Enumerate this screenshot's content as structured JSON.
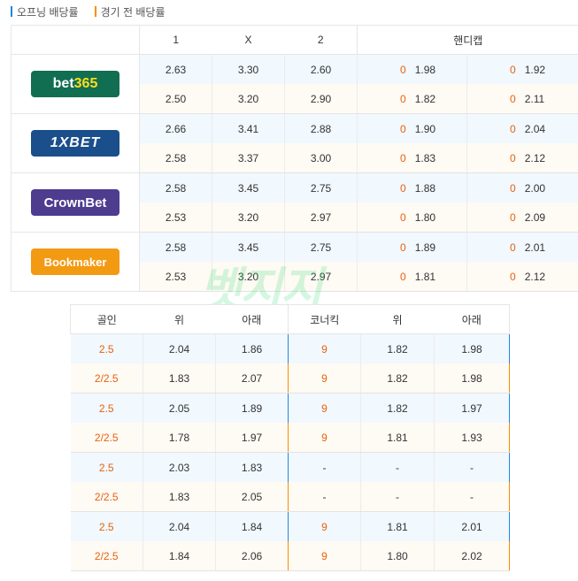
{
  "legend": {
    "opening": "오프닝 배당률",
    "pre_match": "경기 전 배당률"
  },
  "top_headers": {
    "one": "1",
    "x": "X",
    "two": "2",
    "handicap": "핸디캡"
  },
  "bookmakers": [
    {
      "name_a": "bet",
      "name_b": "365",
      "open": [
        "2.63",
        "3.30",
        "2.60",
        "0",
        "1.98",
        "0",
        "1.92"
      ],
      "close": [
        "2.50",
        "3.20",
        "2.90",
        "0",
        "1.82",
        "0",
        "2.11"
      ]
    },
    {
      "name": "1XBET",
      "open": [
        "2.66",
        "3.41",
        "2.88",
        "0",
        "1.90",
        "0",
        "2.04"
      ],
      "close": [
        "2.58",
        "3.37",
        "3.00",
        "0",
        "1.83",
        "0",
        "2.12"
      ]
    },
    {
      "name": "CrownBet",
      "open": [
        "2.58",
        "3.45",
        "2.75",
        "0",
        "1.88",
        "0",
        "2.00"
      ],
      "close": [
        "2.53",
        "3.20",
        "2.97",
        "0",
        "1.80",
        "0",
        "2.09"
      ]
    },
    {
      "name": "Bookmaker",
      "open": [
        "2.58",
        "3.45",
        "2.75",
        "0",
        "1.89",
        "0",
        "2.01"
      ],
      "close": [
        "2.53",
        "3.20",
        "2.97",
        "0",
        "1.81",
        "0",
        "2.12"
      ]
    }
  ],
  "bottom_headers": {
    "goal": "골인",
    "over": "위",
    "under": "아래",
    "corner": "코너킥",
    "over2": "위",
    "under2": "아래"
  },
  "bottom_rows": [
    [
      "2.5",
      "2.04",
      "1.86",
      "9",
      "1.82",
      "1.98"
    ],
    [
      "2/2.5",
      "1.83",
      "2.07",
      "9",
      "1.82",
      "1.98"
    ],
    [
      "2.5",
      "2.05",
      "1.89",
      "9",
      "1.82",
      "1.97"
    ],
    [
      "2/2.5",
      "1.78",
      "1.97",
      "9",
      "1.81",
      "1.93"
    ],
    [
      "2.5",
      "2.03",
      "1.83",
      "-",
      "-",
      "-"
    ],
    [
      "2/2.5",
      "1.83",
      "2.05",
      "-",
      "-",
      "-"
    ],
    [
      "2.5",
      "2.04",
      "1.84",
      "9",
      "1.81",
      "2.01"
    ],
    [
      "2/2.5",
      "1.84",
      "2.06",
      "9",
      "1.80",
      "2.02"
    ]
  ],
  "watermark": "벳지지",
  "colors": {
    "opening_accent": "#1e88e5",
    "pre_match_accent": "#fb8c00",
    "handicap_line": "#e8620c"
  }
}
